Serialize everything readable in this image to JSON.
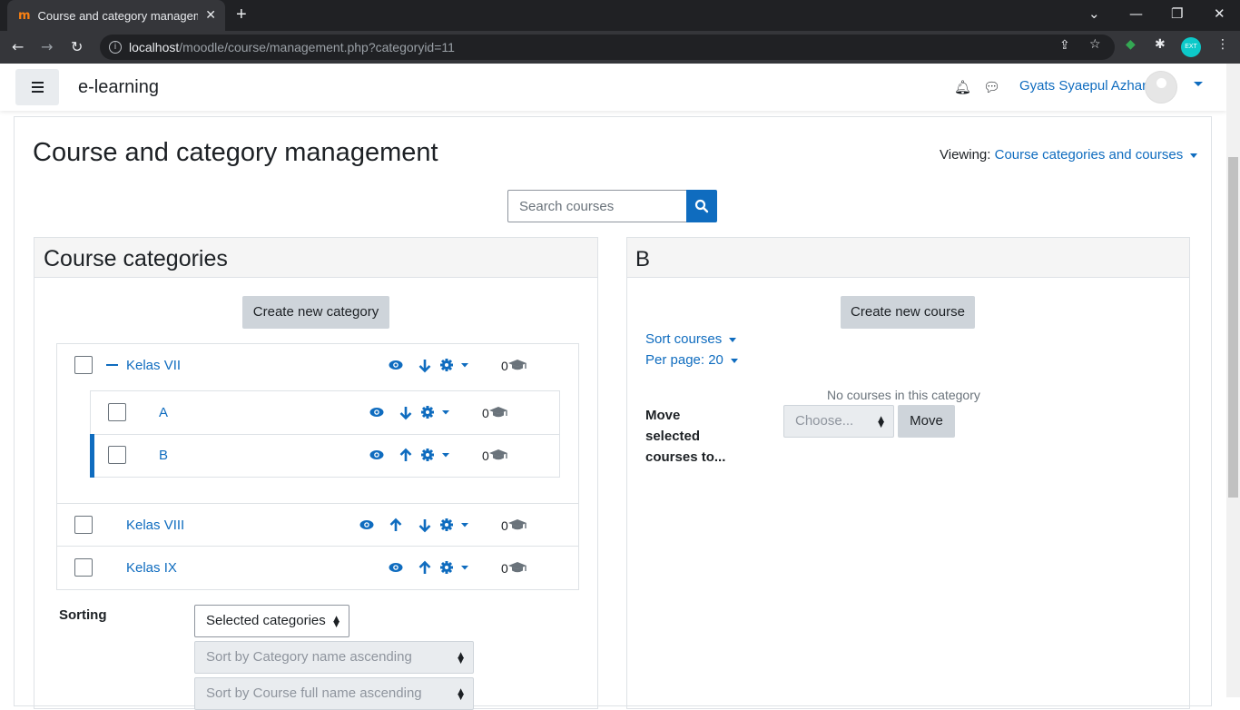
{
  "browser": {
    "tab_title": "Course and category management",
    "url_host": "localhost",
    "url_path": "/moodle/course/management.php?categoryid=11",
    "profile_initials": "EXT"
  },
  "navbar": {
    "site_name": "e-learning",
    "user_name": "Gyats Syaepul Azhar"
  },
  "page": {
    "title": "Course and category management",
    "viewing_label": "Viewing:",
    "viewing_value": "Course categories and courses",
    "search_placeholder": "Search courses"
  },
  "categories_panel": {
    "title": "Course categories",
    "create_button": "Create new category",
    "items": [
      {
        "name": "Kelas VII",
        "count": "0"
      },
      {
        "name": "A",
        "count": "0"
      },
      {
        "name": "B",
        "count": "0"
      },
      {
        "name": "Kelas VIII",
        "count": "0"
      },
      {
        "name": "Kelas IX",
        "count": "0"
      }
    ],
    "sorting_label": "Sorting",
    "sort_scope": "Selected categories",
    "sort_category": "Sort by Category name ascending",
    "sort_course": "Sort by Course full name ascending"
  },
  "courses_panel": {
    "title": "B",
    "create_button": "Create new course",
    "sort_courses": "Sort courses",
    "per_page": "Per page: 20",
    "empty_text": "No courses in this category",
    "move_label": "Move selected courses to...",
    "move_select": "Choose...",
    "move_button": "Move"
  },
  "colors": {
    "accent": "#0f6cbf",
    "button_grey": "#ced4da"
  }
}
